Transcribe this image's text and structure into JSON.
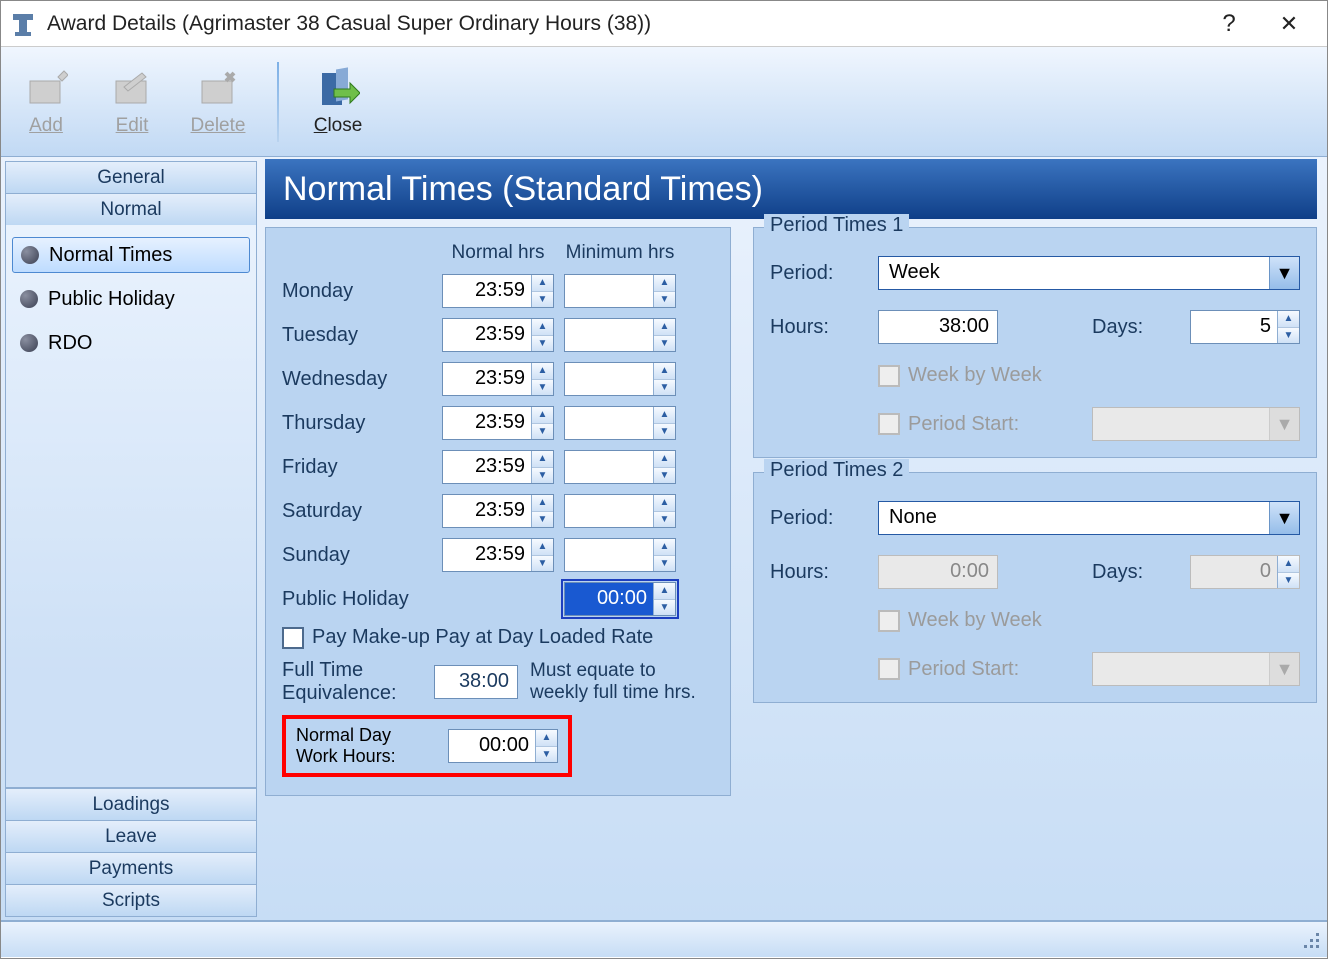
{
  "window": {
    "title": "Award Details (Agrimaster 38 Casual Super Ordinary Hours (38))",
    "help": "?",
    "close": "✕"
  },
  "toolbar": {
    "add": "Add",
    "edit": "Edit",
    "delete": "Delete",
    "close": "Close"
  },
  "sidebar": {
    "top": [
      "General",
      "Normal"
    ],
    "tree": [
      "Normal Times",
      "Public Holiday",
      "RDO"
    ],
    "tree_selected_index": 0,
    "bottom": [
      "Loadings",
      "Leave",
      "Payments",
      "Scripts"
    ]
  },
  "page": {
    "title": "Normal Times (Standard Times)"
  },
  "days": {
    "header_normal": "Normal hrs",
    "header_min": "Minimum hrs",
    "rows": [
      {
        "label": "Monday",
        "normal": "23:59",
        "min": ""
      },
      {
        "label": "Tuesday",
        "normal": "23:59",
        "min": ""
      },
      {
        "label": "Wednesday",
        "normal": "23:59",
        "min": ""
      },
      {
        "label": "Thursday",
        "normal": "23:59",
        "min": ""
      },
      {
        "label": "Friday",
        "normal": "23:59",
        "min": ""
      },
      {
        "label": "Saturday",
        "normal": "23:59",
        "min": ""
      },
      {
        "label": "Sunday",
        "normal": "23:59",
        "min": ""
      }
    ],
    "public_holiday_label": "Public Holiday",
    "public_holiday_min": "00:00",
    "makeup_label": "Pay Make-up Pay at Day Loaded Rate",
    "fte_label": "Full Time Equivalence:",
    "fte_value": "38:00",
    "fte_note": "Must equate to weekly full time hrs.",
    "normal_day_label": "Normal Day Work Hours:",
    "normal_day_value": "00:00"
  },
  "period1": {
    "legend": "Period Times 1",
    "period_label": "Period:",
    "period_value": "Week",
    "hours_label": "Hours:",
    "hours_value": "38:00",
    "days_label": "Days:",
    "days_value": "5",
    "week_by_week_label": "Week by Week",
    "period_start_label": "Period Start:"
  },
  "period2": {
    "legend": "Period Times 2",
    "period_label": "Period:",
    "period_value": "None",
    "hours_label": "Hours:",
    "hours_value": "0:00",
    "days_label": "Days:",
    "days_value": "0",
    "week_by_week_label": "Week by Week",
    "period_start_label": "Period Start:"
  }
}
